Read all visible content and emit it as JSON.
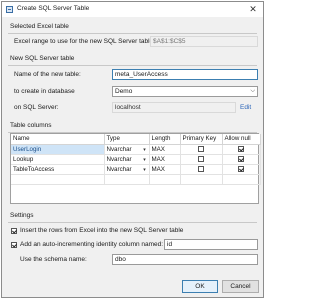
{
  "window": {
    "title": "Create SQL Server Table",
    "close_glyph": "✕"
  },
  "selected_excel": {
    "header": "Selected Excel table",
    "range_label": "Excel range to use for the new SQL Server table:",
    "range_value": "$A$1:$C$5"
  },
  "new_table": {
    "header": "New SQL Server table",
    "name_label": "Name of the new table:",
    "name_value": "meta_UserAccess",
    "database_label": "to create in database",
    "database_value": "Demo",
    "server_label": "on SQL Server:",
    "server_value": "localhost",
    "edit_link": "Edit"
  },
  "columns": {
    "header": "Table columns",
    "col_name": "Name",
    "col_type": "Type",
    "col_length": "Length",
    "col_pk": "Primary Key",
    "col_null": "Allow null",
    "rows": [
      {
        "name": "UserLogin",
        "type": "Nvarchar",
        "length": "MAX",
        "pk": false,
        "null": true,
        "selected": true
      },
      {
        "name": "Lookup",
        "type": "Nvarchar",
        "length": "MAX",
        "pk": false,
        "null": true,
        "selected": false
      },
      {
        "name": "TableToAccess",
        "type": "Nvarchar",
        "length": "MAX",
        "pk": false,
        "null": true,
        "selected": false
      }
    ]
  },
  "settings": {
    "header": "Settings",
    "insert_rows_label": "Insert the rows from Excel into the new SQL Server table",
    "insert_rows_checked": true,
    "identity_label": "Add an auto-incrementing identity column named:",
    "identity_checked": true,
    "identity_value": "id",
    "schema_label": "Use the schema name:",
    "schema_value": "dbo"
  },
  "buttons": {
    "ok": "OK",
    "cancel": "Cancel"
  }
}
